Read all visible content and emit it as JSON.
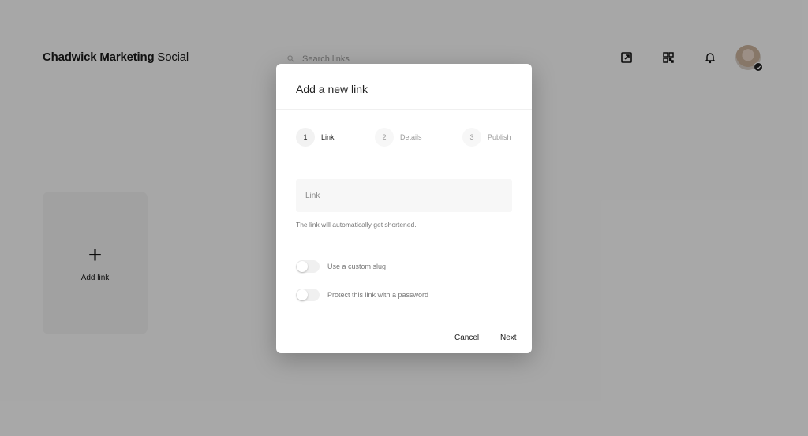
{
  "app": {
    "brand_bold": "Chadwick Marketing",
    "brand_regular": "Social",
    "search_placeholder": "Search links",
    "add_link_label": "Add link"
  },
  "icons": {
    "open_external": "open-external-icon",
    "qr": "qr-code-icon",
    "bell": "bell-icon",
    "search": "search-icon",
    "verified": "check-icon"
  },
  "modal": {
    "title": "Add a new link",
    "steps": [
      {
        "num": "1",
        "label": "Link",
        "active": true
      },
      {
        "num": "2",
        "label": "Details",
        "active": false
      },
      {
        "num": "3",
        "label": "Publish",
        "active": false
      }
    ],
    "link_placeholder": "Link",
    "hint": "The link will automatically get shortened.",
    "toggle_custom_slug": "Use a custom slug",
    "toggle_password": "Protect this link with a password",
    "cancel_label": "Cancel",
    "next_label": "Next"
  }
}
